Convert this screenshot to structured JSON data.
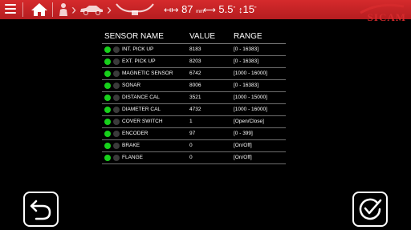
{
  "topbar": {
    "distance_value": "87",
    "distance_unit": "mm",
    "diameter_value": "5.5",
    "diameter_unit": "\"",
    "width_value": "15",
    "width_unit": "\""
  },
  "logo": {
    "text": "SICAM"
  },
  "table": {
    "headers": {
      "name": "SENSOR NAME",
      "value": "VALUE",
      "range": "RANGE"
    },
    "rows": [
      {
        "name": "INT. PICK UP",
        "value": "8183",
        "range": "[0 - 16383]"
      },
      {
        "name": "EXT. PICK UP",
        "value": "8203",
        "range": "[0 - 16383]"
      },
      {
        "name": "MAGNETIC SENSOR",
        "value": "6742",
        "range": "[1000 - 16000]"
      },
      {
        "name": "SONAR",
        "value": "8006",
        "range": "[0 - 16383]"
      },
      {
        "name": "DISTANCE CAL",
        "value": "3521",
        "range": "[1000 - 15000]"
      },
      {
        "name": "DIAMETER CAL",
        "value": "4732",
        "range": "[1000 - 16000]"
      },
      {
        "name": "COVER SWITCH",
        "value": "1",
        "range": "[Open/Close]"
      },
      {
        "name": "ENCODER",
        "value": "97",
        "range": "[0 - 399]"
      },
      {
        "name": "BRAKE",
        "value": "0",
        "range": "[On/Off]"
      },
      {
        "name": "FLANGE",
        "value": "0",
        "range": "[On/Off]"
      }
    ]
  },
  "colors": {
    "topbar": "#c8232a",
    "led_on": "#17d11b",
    "led_off": "#3a3a3a",
    "logo": "#d52a2c"
  },
  "icons": [
    "menu-icon",
    "home-icon",
    "operator-icon",
    "car-icon",
    "wheel-balancer-icon",
    "back-arrow-icon",
    "confirm-check-icon"
  ]
}
